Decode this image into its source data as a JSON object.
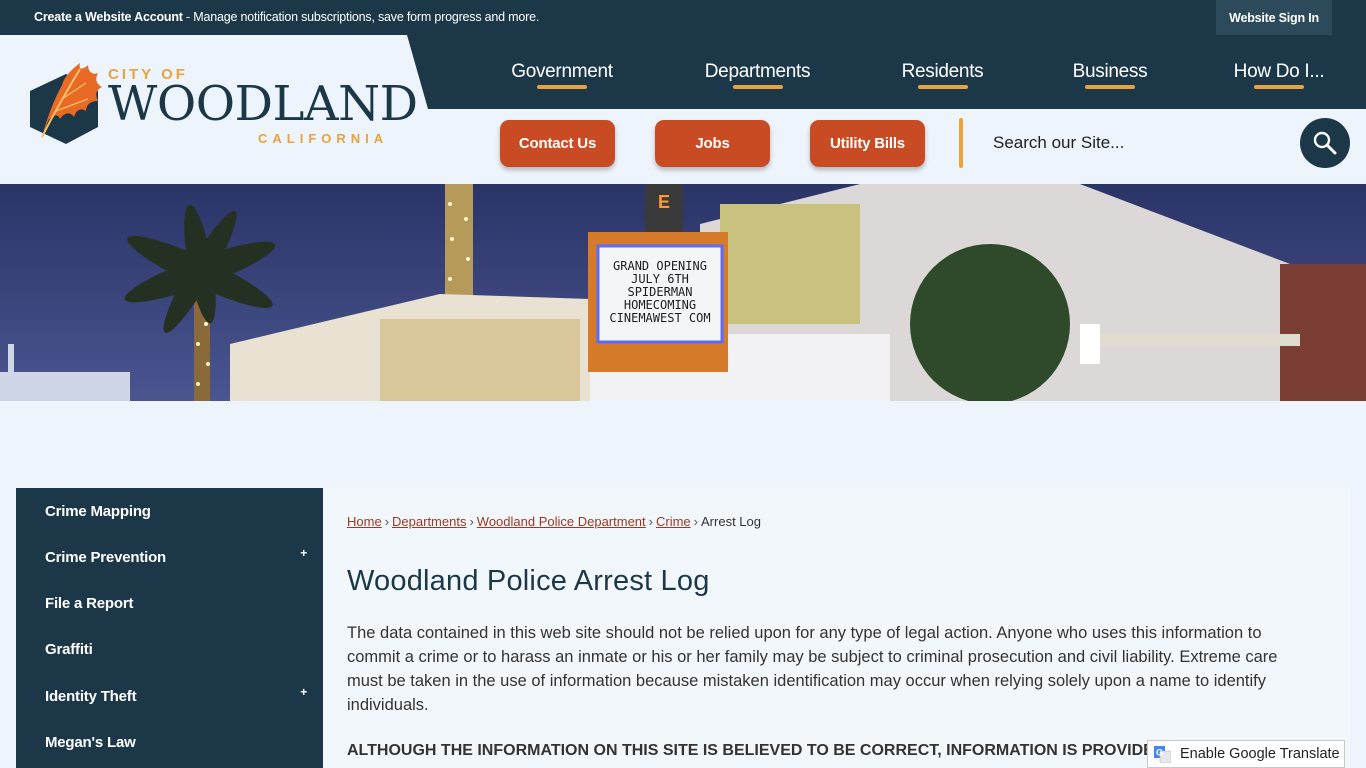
{
  "topbar": {
    "account_link": "Create a Website Account",
    "account_desc": " - Manage notification subscriptions, save form progress and more.",
    "sign_in": "Website Sign In"
  },
  "logo": {
    "city_of": "CITY OF",
    "name": "WOODLAND",
    "state": "CALIFORNIA"
  },
  "main_nav": [
    "Government",
    "Departments",
    "Residents",
    "Business",
    "How Do I..."
  ],
  "quick_links": [
    "Contact Us",
    "Jobs",
    "Utility Bills"
  ],
  "search": {
    "placeholder": "Search our Site..."
  },
  "hero": {
    "marquee_lines": [
      "GRAND OPENING",
      "JULY 6TH",
      "SPIDERMAN",
      "HOMECOMING",
      "CINEMAWEST COM"
    ]
  },
  "side_nav": [
    {
      "label": "Crime Mapping",
      "expandable": false
    },
    {
      "label": "Crime Prevention",
      "expandable": true
    },
    {
      "label": "File a Report",
      "expandable": false
    },
    {
      "label": "Graffiti",
      "expandable": false
    },
    {
      "label": "Identity Theft",
      "expandable": true
    },
    {
      "label": "Megan's Law",
      "expandable": false
    }
  ],
  "breadcrumb": {
    "links": [
      "Home",
      "Departments",
      "Woodland Police Department",
      "Crime"
    ],
    "current": "Arrest Log",
    "separator": "›"
  },
  "page": {
    "title": "Woodland Police Arrest Log",
    "disclaimer": "The data contained in this web site should not be relied upon for any type of legal action. Anyone who uses this information to commit a crime or to harass an inmate or his or her family may be subject to criminal prosecution and civil liability. Extreme care must be taken in the use of information because mistaken identification may occur when relying solely upon a name to identify individuals.",
    "caps_notice": "ALTHOUGH THE INFORMATION ON THIS SITE IS BELIEVED TO BE CORRECT, INFORMATION IS PROVIDED C"
  },
  "translate": {
    "label": "Enable Google Translate"
  },
  "colors": {
    "navy": "#1c3848",
    "accent_orange": "#e8a33d",
    "button_red": "#c84b23",
    "background": "#eef4fb"
  }
}
